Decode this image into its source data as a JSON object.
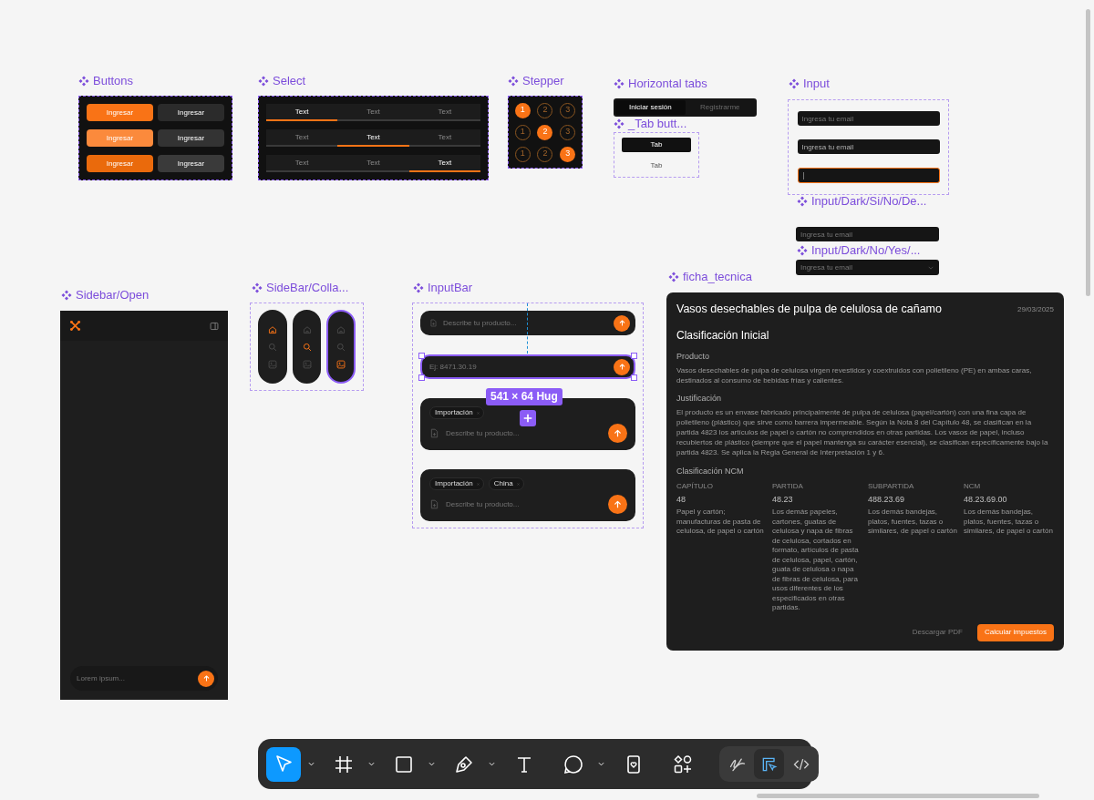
{
  "buttons": {
    "label": "Buttons",
    "rows": [
      [
        {
          "text": "Ingresar",
          "color": "#f97316"
        },
        {
          "text": "Ingresar",
          "color": "#2b2b2b"
        }
      ],
      [
        {
          "text": "Ingresar",
          "color": "#fb8a3c"
        },
        {
          "text": "Ingresar",
          "color": "#333333"
        }
      ],
      [
        {
          "text": "Ingresar",
          "color": "#ea6a0c"
        },
        {
          "text": "Ingresar",
          "color": "#3a3a3a"
        }
      ]
    ]
  },
  "select": {
    "label": "Select",
    "rows": [
      [
        {
          "text": "Text",
          "selected": true
        },
        {
          "text": "Text",
          "selected": false
        },
        {
          "text": "Text",
          "selected": false
        }
      ],
      [
        {
          "text": "Text",
          "selected": false
        },
        {
          "text": "Text",
          "selected": true
        },
        {
          "text": "Text",
          "selected": false
        }
      ],
      [
        {
          "text": "Text",
          "selected": false
        },
        {
          "text": "Text",
          "selected": false
        },
        {
          "text": "Text",
          "selected": true
        }
      ]
    ]
  },
  "stepper": {
    "label": "Stepper",
    "rows": [
      [
        {
          "text": "1",
          "selected": true
        },
        {
          "text": "2",
          "selected": false
        },
        {
          "text": "3",
          "selected": false
        }
      ],
      [
        {
          "text": "1",
          "selected": false
        },
        {
          "text": "2",
          "selected": true
        },
        {
          "text": "3",
          "selected": false
        }
      ],
      [
        {
          "text": "1",
          "selected": false
        },
        {
          "text": "2",
          "selected": false
        },
        {
          "text": "3",
          "selected": true
        }
      ]
    ]
  },
  "horizontal_tabs": {
    "label": "Horizontal tabs",
    "tabs": [
      {
        "text": "Iniciar sesión",
        "selected": true
      },
      {
        "text": "Registrarme",
        "selected": false
      }
    ]
  },
  "tab_button": {
    "label": "_Tab butt...",
    "tabs": [
      {
        "text": "Tab",
        "selected": true
      },
      {
        "text": "Tab",
        "selected": false
      }
    ]
  },
  "input": {
    "label": "Input",
    "fields": [
      {
        "placeholder": "Ingresa tu email",
        "hovered": false,
        "focused": false
      },
      {
        "placeholder": "Ingresa tu email",
        "hovered": true,
        "focused": false
      },
      {
        "focused": true
      }
    ]
  },
  "input_variant_a": {
    "label": "Input/Dark/Si/No/De...",
    "placeholder": "Ingresa tu email"
  },
  "input_variant_b": {
    "label": "Input/Dark/No/Yes/...",
    "placeholder": "Ingresa tu email"
  },
  "sidebar_open": {
    "label": "Sidebar/Open",
    "input_placeholder": "Lorem ipsum..."
  },
  "sidebar_collapsed": {
    "label": "SideBar/Colla...",
    "pills": [
      {
        "selected": false,
        "items": [
          {
            "kind": "home",
            "selected": true
          },
          {
            "kind": "search",
            "selected": false
          },
          {
            "kind": "image",
            "selected": false
          }
        ]
      },
      {
        "selected": false,
        "items": [
          {
            "kind": "home",
            "selected": false
          },
          {
            "kind": "search",
            "selected": true
          },
          {
            "kind": "image",
            "selected": false
          }
        ]
      },
      {
        "selected": true,
        "items": [
          {
            "kind": "home",
            "selected": false
          },
          {
            "kind": "search",
            "selected": false
          },
          {
            "kind": "image",
            "selected": true
          }
        ]
      }
    ]
  },
  "input_bar": {
    "label": "InputBar",
    "size_badge": "541 × 64 Hug",
    "bars": [
      {
        "kind": "simple",
        "attach": true,
        "placeholder": "Describe tu producto...",
        "selected": false
      },
      {
        "kind": "simple",
        "attach": false,
        "placeholder": "Ej: 8471.30.19",
        "selected": true
      },
      {
        "kind": "tags",
        "tags": [
          "Importación"
        ],
        "placeholder": "Describe tu producto...",
        "selected": false
      },
      {
        "kind": "tags",
        "tags": [
          "Importación",
          "China"
        ],
        "placeholder": "Describe tu producto...",
        "selected": false
      }
    ]
  },
  "ficha_tecnica": {
    "label": "ficha_tecnica",
    "title": "Vasos desechables de pulpa de celulosa de cañamo",
    "date": "29/03/2025",
    "heading": "Clasificación Inicial",
    "sections": [
      {
        "heading": "Producto",
        "text": "Vasos desechables de pulpa de celulosa virgen revestidos y coextruidos con polietileno (PE) en ambas caras, destinados al consumo de bebidas frías y calientes."
      },
      {
        "heading": "Justificación",
        "text": "El producto es un envase fabricado principalmente de pulpa de celulosa (papel/cartón) con una fina capa de polietileno (plástico) que sirve como barrera impermeable. Según la Nota 8 del Capítulo 48, se clasifican en la partida 4823 los artículos de papel o cartón no comprendidos en otras partidas. Los vasos de papel, incluso recubiertos de plástico (siempre que el papel mantenga su carácter esencial), se clasifican específicamente bajo la partida 4823. Se aplica la Regla General de Interpretación 1 y 6."
      }
    ],
    "ncm_heading": "Clasificación NCM",
    "ncm_columns": [
      {
        "label": "CAPÍTULO",
        "code": "48",
        "description": "Papel y cartón; manufacturas de pasta de celulosa, de papel o cartón"
      },
      {
        "label": "PARTIDA",
        "code": "48.23",
        "description": "Los demás papeles, cartones, guatas de celulosa y napa de fibras de celulosa, cortados en formato, artículos de pasta de celulosa, papel, cartón, guata de celulosa o napa de fibras de celulosa, para usos diferentes de los especificados en otras partidas."
      },
      {
        "label": "SUBPARTIDA",
        "code": "488.23.69",
        "description": "Los demás bandejas, platos, fuentes, tazas o similares, de papel o cartón"
      },
      {
        "label": "NCM",
        "code": "48.23.69.00",
        "description": "Los demás bandejas, platos, fuentes, tazas o similares, de papel o cartón"
      }
    ],
    "secondary_button": "Descargar PDF",
    "primary_button": "Calcular impuestos"
  },
  "toolbar": {
    "tools": [
      {
        "kind": "move",
        "selected": true,
        "has_menu": true
      },
      {
        "kind": "frame",
        "selected": false,
        "has_menu": true
      },
      {
        "kind": "rectangle",
        "selected": false,
        "has_menu": true
      },
      {
        "kind": "pen",
        "selected": false,
        "has_menu": true
      },
      {
        "kind": "text",
        "selected": false,
        "has_menu": false
      },
      {
        "kind": "comment",
        "selected": false,
        "has_menu": true
      },
      {
        "kind": "resources",
        "selected": false,
        "has_menu": false
      },
      {
        "kind": "actions",
        "selected": false,
        "has_menu": false
      }
    ],
    "modes": [
      {
        "kind": "draw",
        "selected": false
      },
      {
        "kind": "design",
        "selected": true
      },
      {
        "kind": "dev",
        "selected": false
      }
    ]
  }
}
